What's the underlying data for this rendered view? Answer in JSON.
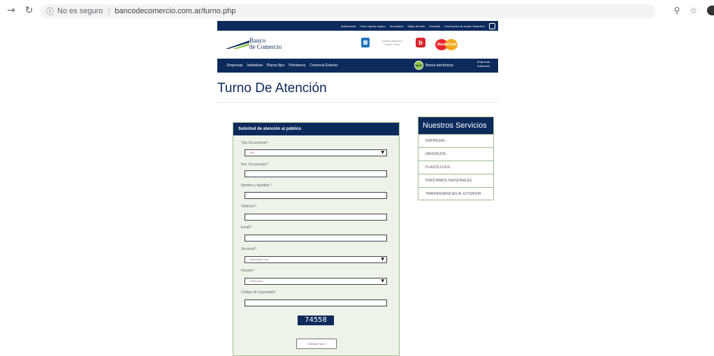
{
  "browser": {
    "back_icon": "arrow-right-icon",
    "reload_icon": "reload-icon",
    "security_icon": "info-icon",
    "security_text": "No es seguro",
    "url": "bancodecomercio.com.ar/turno.php"
  },
  "topbar": {
    "links": [
      "Institucional",
      "Cómo operar seguro",
      "Sucursales",
      "Mapa del sitio",
      "Contacto",
      "Información al usuario financiero"
    ]
  },
  "header": {
    "logo_line1": "Banco",
    "logo_line2": "de Comercio",
    "turno_text": "Solicitá atención Online Turno",
    "bna_text": "b",
    "mastercard_text": "MasterCard"
  },
  "nav": {
    "items": [
      "Empresas",
      "Individuos",
      "Plazos fijos",
      "Préstamos",
      "Comercio Exterior"
    ],
    "banca_electronica": "Banca electrónica",
    "ebank_circle": "BdeC",
    "empresas_individuos": "Empresas Individuos"
  },
  "page": {
    "title": "Turno De Atención"
  },
  "form": {
    "title": "Solicitud de atención al público",
    "tipo_documento_label": "Tipo Documento*:",
    "tipo_documento_value": "DNI",
    "nro_documento_label": "Nro. Documento*:",
    "nombre_label": "Nombre y Apellido *",
    "telefono_label": "Teléfono*:",
    "email_label": "Email*:",
    "sucursal_label": "Sucursal*:",
    "sucursal_value": "Seleccione una",
    "horario_label": "Horario*:",
    "horario_value": "Seleccione",
    "codigo_label": "Código de Seguridad*:",
    "captcha": "74558",
    "submit": "Solicitar Turno"
  },
  "services": {
    "title": "Nuestros Servicios",
    "items": [
      "EMPRESAS",
      "INDIVIDUOS",
      "PLAZOS FIJOS",
      "PRÉSTAMOS PERSONALES",
      "TRANSFERENCIAS AL EXTERIOR"
    ]
  },
  "colors": {
    "brand_navy": "#0d2a5c",
    "panel_green": "#eef3ea",
    "border_green": "#9dbb8a"
  }
}
